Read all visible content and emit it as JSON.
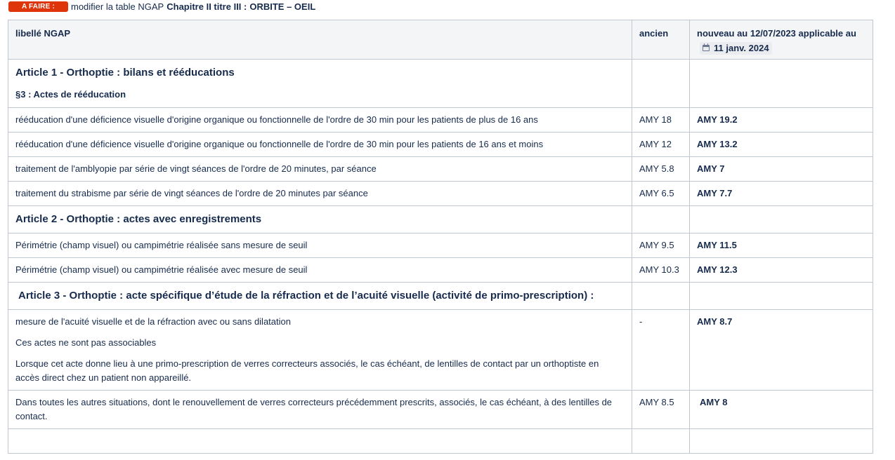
{
  "header": {
    "status_badge": "A FAIRE :",
    "intro_text": "modifier la table NGAP",
    "chapter": "Chapitre II titre III :",
    "subject": "ORBITE – OEIL"
  },
  "table": {
    "columns": {
      "label": "libellé NGAP",
      "old": "ancien",
      "new_prefix": "nouveau au 12/07/2023 applicable au",
      "new_date": "11 janv. 2024"
    },
    "article1": {
      "title": "Article 1 - Orthoptie : bilans et rééducations",
      "subtitle": "§3 : Actes de rééducation",
      "rows": [
        {
          "label": "rééducation d'une déficience visuelle d'origine organique ou fonctionnelle de l'ordre de 30 min pour les patients de plus de 16 ans",
          "old": "AMY 18",
          "new": "AMY 19.2"
        },
        {
          "label": "rééducation d'une déficience visuelle d'origine organique ou fonctionnelle de l'ordre de 30 min pour les patients de 16 ans et moins",
          "old": "AMY 12",
          "new": "AMY 13.2"
        },
        {
          "label": "traitement de l'amblyopie par série de vingt séances de l'ordre de 20 minutes, par séance",
          "old": "AMY 5.8",
          "new": "AMY 7"
        },
        {
          "label": "traitement du strabisme par série de vingt séances de l'ordre de 20 minutes par séance",
          "old": "AMY 6.5",
          "new": "AMY 7.7"
        }
      ]
    },
    "article2": {
      "title": "Article 2 - Orthoptie : actes avec enregistrements",
      "rows": [
        {
          "label": "Périmétrie (champ visuel) ou campimétrie réalisée sans mesure de seuil",
          "old": "AMY 9.5",
          "new": "AMY 11.5"
        },
        {
          "label": "Périmétrie (champ visuel) ou campimétrie réalisée avec mesure de seuil",
          "old": "AMY 10.3",
          "new": "AMY 12.3"
        }
      ]
    },
    "article3": {
      "title": "Article 3 - Orthoptie : acte spécifique d’étude de la réfraction et de l’acuité visuelle (activité de primo-prescription) :",
      "row1": {
        "label": "mesure de l'acuité visuelle et de la réfraction avec ou sans dilatation",
        "note1": "Ces actes ne sont pas associables",
        "note2": "Lorsque cet acte donne lieu à une primo-prescription de verres correcteurs associés, le cas échéant, de lentilles de contact par un orthoptiste en accès direct chez un patient non appareillé.",
        "old": "-",
        "new": "AMY 8.7"
      },
      "row2": {
        "label": "Dans toutes les autres situations, dont le renouvellement de verres correcteurs précédemment prescrits, associés, le cas échéant, à des lentilles de contact.",
        "old": "AMY 8.5",
        "new": "AMY 8"
      }
    }
  }
}
